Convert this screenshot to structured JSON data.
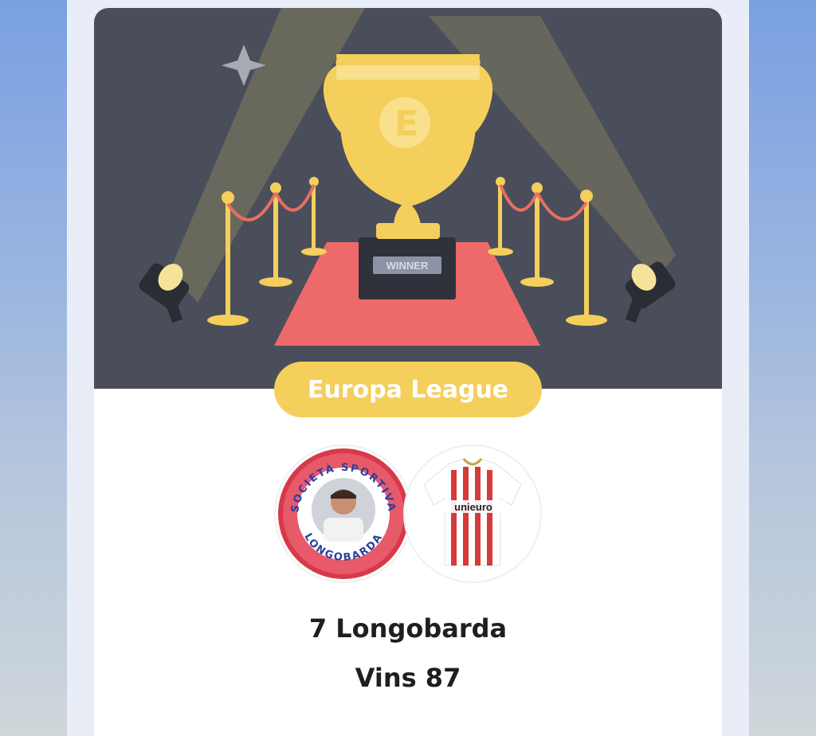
{
  "competition": {
    "name": "Europa League",
    "plaque_label": "WINNER",
    "trophy_monogram": "E"
  },
  "team": {
    "rank_and_name": "7 Longobarda",
    "wins_label": "Vins 87",
    "crest_text_top": "SOCIETÀ SPORTIVA",
    "crest_text_bottom": "LONGOBARDA",
    "kit_sponsor": "unieuro"
  },
  "colors": {
    "banner_bg": "#4a4e5a",
    "accent_yellow": "#f4cf5c",
    "carpet_red": "#ee6a6a",
    "rope_red": "#e86f62"
  }
}
